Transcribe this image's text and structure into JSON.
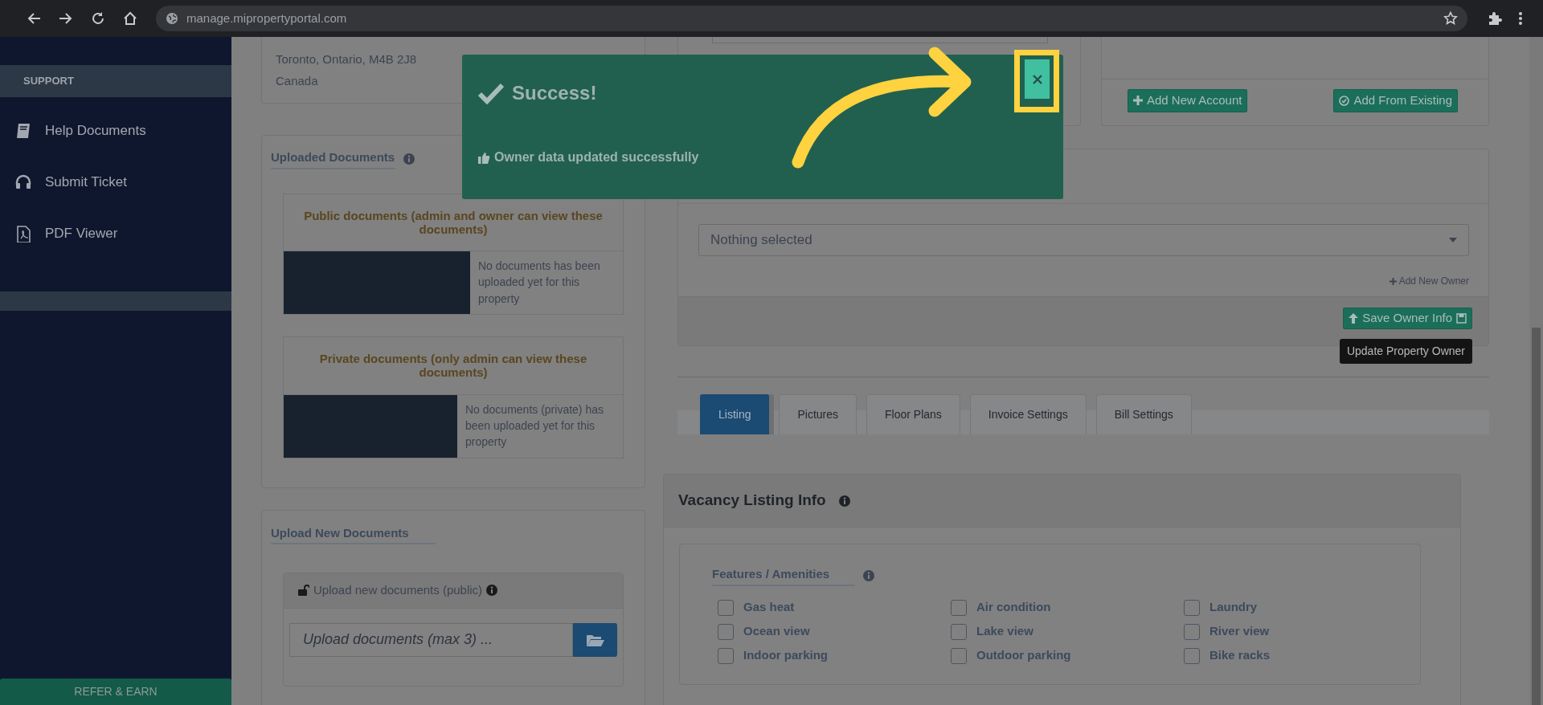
{
  "browser": {
    "url": "manage.mipropertyportal.com"
  },
  "sidebar": {
    "section": "SUPPORT",
    "items": [
      {
        "label": "Help Documents"
      },
      {
        "label": "Submit Ticket"
      },
      {
        "label": "PDF Viewer"
      }
    ],
    "refer_button": "REFER & EARN"
  },
  "address": [
    "Toronto, Ontario, M4B 2J8",
    "Canada"
  ],
  "uploaded_documents": {
    "title": "Uploaded Documents",
    "panels": [
      {
        "heading": "Public documents (admin and owner can view these documents)",
        "message": "No documents has been uploaded yet for this property"
      },
      {
        "heading": "Private documents (only admin can view these documents)",
        "message": "No documents (private) has been uploaded yet for this property"
      }
    ]
  },
  "upload_new": {
    "title": "Upload New Documents",
    "panel_heading": "Upload new documents (public)",
    "placeholder": "Upload documents (max 3) ..."
  },
  "accounts": {
    "buttons": [
      "Add New Account",
      "Add From Existing"
    ]
  },
  "property_owner": {
    "select_value": "Nothing selected",
    "add_link": "Add New Owner",
    "save_button": "Save Owner Info",
    "tooltip": "Update Property Owner"
  },
  "tabs": [
    {
      "label": "Listing",
      "selected": true
    },
    {
      "label": "Pictures",
      "selected": false
    },
    {
      "label": "Floor Plans",
      "selected": false
    },
    {
      "label": "Invoice Settings",
      "selected": false
    },
    {
      "label": "Bill Settings",
      "selected": false
    }
  ],
  "vacancy": {
    "title": "Vacancy Listing Info",
    "features_title": "Features / Amenities",
    "amenities": [
      {
        "label": "Gas heat",
        "checked": false
      },
      {
        "label": "Air condition",
        "checked": false
      },
      {
        "label": "Laundry",
        "checked": false
      },
      {
        "label": "Ocean view",
        "checked": false
      },
      {
        "label": "Lake view",
        "checked": false
      },
      {
        "label": "River view",
        "checked": false
      },
      {
        "label": "Indoor parking",
        "checked": false
      },
      {
        "label": "Outdoor parking",
        "checked": false
      },
      {
        "label": "Bike racks",
        "checked": false
      }
    ]
  },
  "modal": {
    "title": "Success!",
    "message": "Owner data updated successfully"
  }
}
